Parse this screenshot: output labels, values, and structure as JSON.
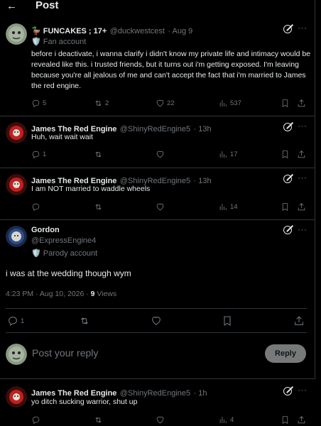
{
  "header": {
    "back_glyph": "←",
    "title": "Post"
  },
  "posts": [
    {
      "name": "🦆 FUNCAKES ; 17+",
      "handle": "@duckwestcest",
      "time": "· Aug 9",
      "badge": "🛡️ Fan account",
      "text": "before i deactivate, i wanna clarify i didn't know my private life and intimacy would be revealed like this. i trusted friends, but it turns out i'm getting exposed. I'm leaving because you're all jealous of me and can't accept the fact that i'm married to James the red engine.",
      "replies": "5",
      "reposts": "2",
      "likes": "22",
      "views": "537"
    },
    {
      "name": "James The Red Engine",
      "handle": "@ShinyRedEngine5",
      "time": "· 13h",
      "text": "Huh, wait wait wait",
      "replies": "1",
      "reposts": "",
      "likes": "",
      "views": "17"
    },
    {
      "name": "James The Red Engine",
      "handle": "@ShinyRedEngine5",
      "time": "· 13h",
      "text": "I am NOT married to waddle wheels",
      "replies": "",
      "reposts": "",
      "likes": "",
      "views": "14"
    }
  ],
  "focus_post": {
    "name": "Gordon",
    "handle": "@ExpressEngine4",
    "badge": "🛡️ Parody account",
    "text": "i was at the wedding though wym",
    "date": "4:23 PM · Aug 10, 2026 · ",
    "view_count": "9",
    "view_label": " Views",
    "replies": "1"
  },
  "reply": {
    "placeholder": "Post your reply",
    "button": "Reply"
  },
  "last_post": {
    "name": "James The Red Engine",
    "handle": "@ShinyRedEngine5",
    "time": "· 1h",
    "text": "yo ditch sucking warrior, shut up",
    "views": "4"
  },
  "more_glyph": "···",
  "icons": [
    "back-arrow-icon",
    "grok-icon",
    "more-icon",
    "reply-icon",
    "repost-icon",
    "like-icon",
    "views-icon",
    "bookmark-icon",
    "share-icon"
  ],
  "colors": {
    "bg": "#000000",
    "text": "#e7e9ea",
    "muted": "#71767b",
    "border": "#2f3336",
    "reply_button": "#787a7a"
  }
}
